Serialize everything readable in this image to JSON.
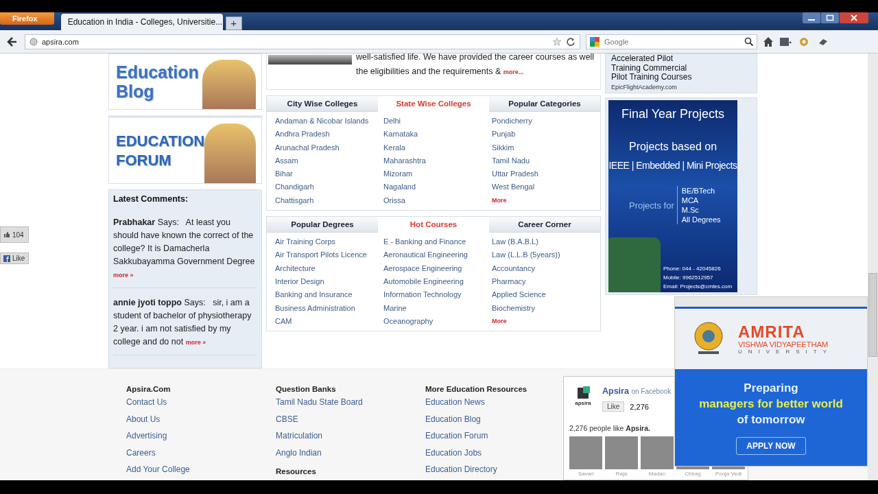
{
  "browser": {
    "app_button": "Firefox",
    "tab_title": "Education in India - Colleges, Universitie...",
    "new_tab": "+",
    "url": "apsira.com",
    "search_placeholder": "Google"
  },
  "social": {
    "count": "104",
    "like": "Like"
  },
  "left": {
    "banners": [
      {
        "kind": "blog",
        "lines": [
          "Education",
          "Blog"
        ]
      },
      {
        "kind": "forum",
        "lines": [
          "EDUCATION",
          "FORUM"
        ]
      }
    ],
    "comments": {
      "title": "Latest Comments:",
      "items": [
        {
          "author": "Prabhakar",
          "says": "Says:",
          "text": "At least you should have known the correct of the college? It is Damacherla Sakkubayamma Government Degree",
          "more": "more »"
        },
        {
          "author": "annie jyoti toppo",
          "says": "Says:",
          "text": "sir, i am a student of bachelor of physiotherapy 2 year. i am not satisfied by my college and do not",
          "more": "more »"
        }
      ]
    }
  },
  "intro": {
    "text": "well-satisfied life. We have provided the career courses as well the eligibilities and the requirements &",
    "more": "more..."
  },
  "panels": [
    {
      "tabs": [
        {
          "label": "City Wise Colleges",
          "selected": false
        },
        {
          "label": "State Wise Colleges",
          "selected": true
        },
        {
          "label": "Popular Categories",
          "selected": false
        }
      ],
      "columns": [
        [
          {
            "label": "Andaman & Nicobar Islands",
            "kind": "link"
          },
          {
            "label": "Andhra Pradesh",
            "kind": "link"
          },
          {
            "label": "Arunachal Pradesh",
            "kind": "link"
          },
          {
            "label": "Assam",
            "kind": "link"
          },
          {
            "label": "Bihar",
            "kind": "link"
          },
          {
            "label": "Chandigarh",
            "kind": "link"
          },
          {
            "label": "Chattisgarh",
            "kind": "link"
          }
        ],
        [
          {
            "label": "Delhi",
            "kind": "link"
          },
          {
            "label": "Karnataka",
            "kind": "link"
          },
          {
            "label": "Kerala",
            "kind": "link"
          },
          {
            "label": "Maharashtra",
            "kind": "link"
          },
          {
            "label": "Mizoram",
            "kind": "link"
          },
          {
            "label": "Nagaland",
            "kind": "link"
          },
          {
            "label": "Orissa",
            "kind": "link"
          }
        ],
        [
          {
            "label": "Pondicherry",
            "kind": "link"
          },
          {
            "label": "Punjab",
            "kind": "link"
          },
          {
            "label": "Sikkim",
            "kind": "link"
          },
          {
            "label": "Tamil Nadu",
            "kind": "link"
          },
          {
            "label": "Uttar Pradesh",
            "kind": "link"
          },
          {
            "label": "West Bengal",
            "kind": "link"
          },
          {
            "label": "More",
            "kind": "more"
          }
        ]
      ]
    },
    {
      "tabs": [
        {
          "label": "Popular Degrees",
          "selected": false
        },
        {
          "label": "Hot Courses",
          "selected": true
        },
        {
          "label": "Career Corner",
          "selected": false
        }
      ],
      "columns": [
        [
          {
            "label": "Air Training Corps",
            "kind": "link"
          },
          {
            "label": "Air Transport Pilots Licence",
            "kind": "link"
          },
          {
            "label": "Architecture",
            "kind": "link"
          },
          {
            "label": "Interior Design",
            "kind": "link"
          },
          {
            "label": "Banking and Insurance",
            "kind": "link"
          },
          {
            "label": "Business Administration",
            "kind": "link"
          },
          {
            "label": "CAM",
            "kind": "link"
          }
        ],
        [
          {
            "label": "E - Banking and Finance",
            "kind": "link"
          },
          {
            "label": "Aeronautical Engineering",
            "kind": "link"
          },
          {
            "label": "Aerospace Engineering",
            "kind": "link"
          },
          {
            "label": "Automobile Engineering",
            "kind": "link"
          },
          {
            "label": "Information Technology",
            "kind": "link"
          },
          {
            "label": "Marine",
            "kind": "link"
          },
          {
            "label": "Oceanography",
            "kind": "link"
          }
        ],
        [
          {
            "label": "Law (B.A.B.L)",
            "kind": "link"
          },
          {
            "label": "Law (L.L.B (5years))",
            "kind": "link"
          },
          {
            "label": "Accountancy",
            "kind": "link"
          },
          {
            "label": "Pharmacy",
            "kind": "link"
          },
          {
            "label": "Applied Science",
            "kind": "link"
          },
          {
            "label": "Biochemistry",
            "kind": "link"
          },
          {
            "label": "More",
            "kind": "more"
          }
        ]
      ]
    }
  ],
  "right": {
    "pilot_ad": {
      "lines": [
        "Accelerated Pilot",
        "Training Commercial",
        "Pilot Training Courses"
      ],
      "url": "EpicFlightAcademy.com"
    },
    "projects_ad": {
      "title": "Final Year Projects",
      "subtitle": "Projects based on",
      "topics": "IEEE | Embedded | Mini Projects",
      "for_label": "Projects for",
      "degrees": [
        "BE/BTech",
        "MCA",
        "M.Sc",
        "All Degrees"
      ],
      "contacts": [
        "Phone: 044 - 42045826",
        "Mobile: 9962512957",
        "Email: Projects@cmtes.com"
      ]
    }
  },
  "footer": {
    "columns": [
      {
        "heading": "Apsira.Com",
        "links": [
          "Contact Us",
          "About Us",
          "Advertising",
          "Careers",
          "Add Your College"
        ]
      },
      {
        "heading": "Question Banks",
        "links": [
          "Tamil Nadu State Board",
          "CBSE",
          "Matriculation",
          "Anglo Indian"
        ],
        "subheading": "Resources"
      },
      {
        "heading": "More Education Resources",
        "links": [
          "Education News",
          "Education Blog",
          "Education Forum",
          "Education Jobs",
          "Education Directory"
        ]
      }
    ],
    "facebook": {
      "page": "Apsira",
      "suffix": "on Facebook",
      "logo_text": "apsira",
      "like": "Like",
      "count": "2,276",
      "people": "2,276 people like **Apsira.**",
      "fans": [
        "Savari",
        "Raja",
        "Madan",
        "Chirag",
        "Pooja Vedi"
      ]
    }
  },
  "popup_ad": {
    "name": "AMRITA",
    "sub": "VISHWA VIDYAPEETHAM",
    "uni": "UNIVERSITY",
    "lines": [
      {
        "text": "Preparing",
        "kind": "plain"
      },
      {
        "text": "managers for better world",
        "kind": "accent"
      },
      {
        "text": "of tomorrow",
        "kind": "plain"
      }
    ],
    "button": "APPLY NOW"
  }
}
